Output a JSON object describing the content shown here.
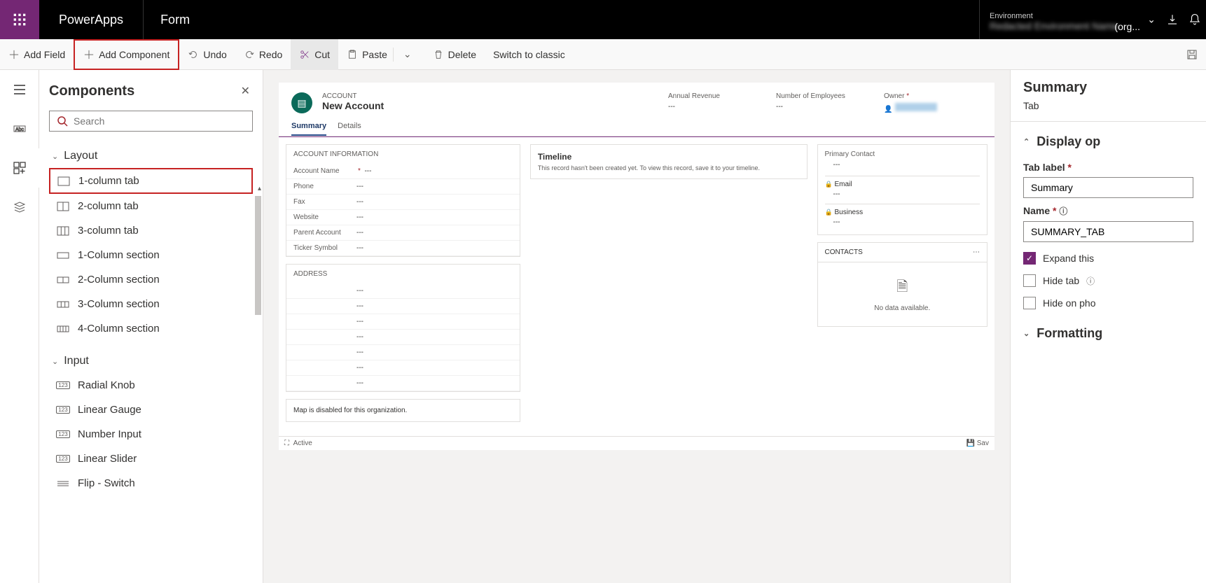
{
  "topbar": {
    "app_name": "PowerApps",
    "page_name": "Form",
    "env_label": "Environment",
    "env_value": "Redacted Environment Name",
    "env_suffix": "(org..."
  },
  "toolbar": {
    "add_field": "Add Field",
    "add_component": "Add Component",
    "undo": "Undo",
    "redo": "Redo",
    "cut": "Cut",
    "paste": "Paste",
    "delete": "Delete",
    "switch_classic": "Switch to classic"
  },
  "components_panel": {
    "title": "Components",
    "search_placeholder": "Search",
    "groups": {
      "layout": {
        "label": "Layout",
        "items": [
          "1-column tab",
          "2-column tab",
          "3-column tab",
          "1-Column section",
          "2-Column section",
          "3-Column section",
          "4-Column section"
        ]
      },
      "input": {
        "label": "Input",
        "items": [
          "Radial Knob",
          "Linear Gauge",
          "Number Input",
          "Linear Slider",
          "Flip - Switch"
        ]
      }
    }
  },
  "form_preview": {
    "entity_overline": "ACCOUNT",
    "title": "New Account",
    "stats": {
      "annual_revenue": {
        "label": "Annual Revenue",
        "value": "---"
      },
      "num_employees": {
        "label": "Number of Employees",
        "value": "---"
      },
      "owner": {
        "label": "Owner"
      }
    },
    "tabs": {
      "summary": "Summary",
      "details": "Details"
    },
    "account_info": {
      "title": "ACCOUNT INFORMATION",
      "fields": [
        {
          "label": "Account Name",
          "value": "---",
          "required": true
        },
        {
          "label": "Phone",
          "value": "---"
        },
        {
          "label": "Fax",
          "value": "---"
        },
        {
          "label": "Website",
          "value": "---"
        },
        {
          "label": "Parent Account",
          "value": "---"
        },
        {
          "label": "Ticker Symbol",
          "value": "---"
        }
      ]
    },
    "address": {
      "title": "ADDRESS",
      "rows": [
        "---",
        "---",
        "---",
        "---",
        "---",
        "---",
        "---"
      ]
    },
    "map_disabled": "Map is disabled for this organization.",
    "timeline": {
      "title": "Timeline",
      "msg": "This record hasn't been created yet. To view this record, save it to your timeline."
    },
    "primary_contact": {
      "label": "Primary Contact",
      "value": "---",
      "email_label": "Email",
      "email_value": "---",
      "business_label": "Business",
      "business_value": "---"
    },
    "contacts": {
      "title": "CONTACTS",
      "empty": "No data available."
    },
    "footer": {
      "status": "Active",
      "save": "Sav"
    }
  },
  "right_panel": {
    "title": "Summary",
    "sub": "Tab",
    "display_options": "Display op",
    "tab_label_field": "Tab label",
    "tab_label_value": "Summary",
    "name_field": "Name",
    "name_value": "SUMMARY_TAB",
    "expand_first": "Expand this",
    "hide_tab": "Hide tab",
    "hide_on_phone": "Hide on pho",
    "formatting": "Formatting"
  }
}
